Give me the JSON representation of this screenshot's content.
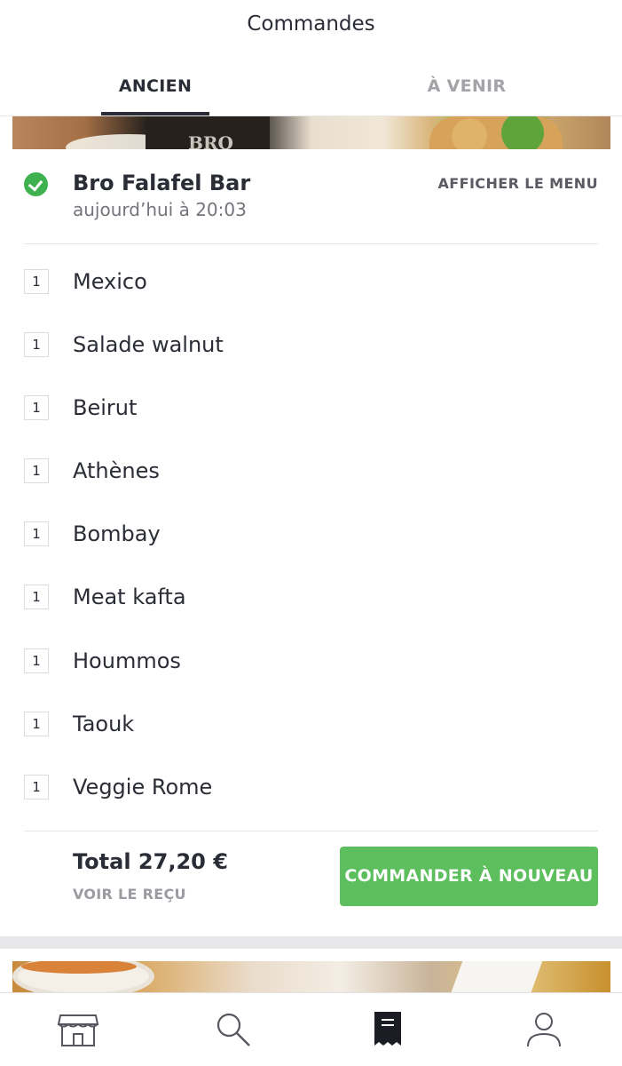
{
  "header": {
    "title": "Commandes",
    "tabs": [
      {
        "label": "ANCIEN",
        "active": true
      },
      {
        "label": "À VENIR",
        "active": false
      }
    ]
  },
  "order": {
    "restaurant": "Bro Falafel Bar",
    "date": "aujourd’hui à 20:03",
    "status_icon": "check-circle-icon",
    "menu_link": "AFFICHER LE MENU",
    "items": [
      {
        "qty": "1",
        "name": "Mexico"
      },
      {
        "qty": "1",
        "name": "Salade walnut"
      },
      {
        "qty": "1",
        "name": "Beirut"
      },
      {
        "qty": "1",
        "name": "Athènes"
      },
      {
        "qty": "1",
        "name": "Bombay"
      },
      {
        "qty": "1",
        "name": "Meat kafta"
      },
      {
        "qty": "1",
        "name": "Hoummos"
      },
      {
        "qty": "1",
        "name": "Taouk"
      },
      {
        "qty": "1",
        "name": "Veggie Rome"
      }
    ],
    "total": "Total 27,20 €",
    "receipt_link": "VOIR LE REÇU",
    "reorder_button": "COMMANDER À NOUVEAU"
  },
  "bottom_nav": [
    {
      "icon": "store-icon",
      "active": false
    },
    {
      "icon": "search-icon",
      "active": false
    },
    {
      "icon": "receipt-icon",
      "active": true
    },
    {
      "icon": "account-icon",
      "active": false
    }
  ],
  "colors": {
    "accent_green": "#5cbe5c",
    "check_green": "#3fb14e",
    "text_dark": "#2b2d36",
    "text_muted": "#74747c"
  }
}
